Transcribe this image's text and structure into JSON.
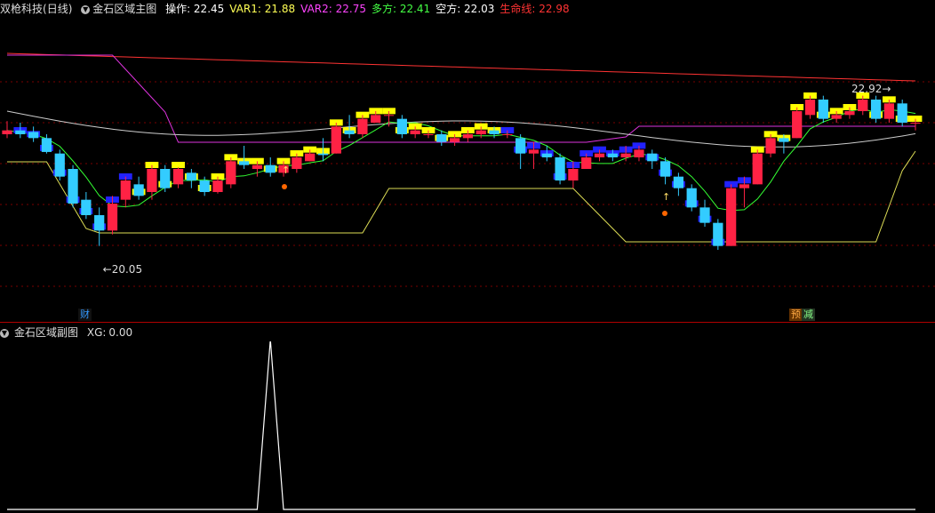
{
  "header": {
    "stock": "双枪科技",
    "period": "(日线)",
    "indicator": "金石区域主图",
    "items": [
      {
        "label": "操作:",
        "value": "22.45",
        "color": "#ffffff"
      },
      {
        "label": "VAR1:",
        "value": "21.88",
        "color": "#ffff55"
      },
      {
        "label": "VAR2:",
        "value": "22.75",
        "color": "#ff44ff"
      },
      {
        "label": "多方:",
        "value": "22.41",
        "color": "#44ff44"
      },
      {
        "label": "空方:",
        "value": "22.03",
        "color": "#ffffff"
      },
      {
        "label": "生命线:",
        "value": "22.98",
        "color": "#ff3333"
      }
    ]
  },
  "main_chart": {
    "high_label": "22.92",
    "low_label": "20.05",
    "badges": [
      {
        "text": "财",
        "color": "#3399ff",
        "bg": "#111"
      },
      {
        "text": "预",
        "color": "#ffaa44",
        "bg": "#663300"
      },
      {
        "text": "减",
        "color": "#88ff88",
        "bg": "#223322"
      }
    ]
  },
  "sub_header": {
    "indicator": "金石区域副图",
    "label": "XG:",
    "value": "0.00"
  },
  "chart_data": {
    "type": "line",
    "series": [
      {
        "name": "XG",
        "values": [
          0,
          0,
          0,
          0,
          0,
          0,
          0,
          0,
          0,
          0,
          0,
          0,
          0,
          0,
          0,
          0,
          0,
          0,
          0,
          0,
          1,
          0,
          0,
          0,
          0,
          0,
          0,
          0,
          0,
          0,
          0,
          0,
          0,
          0,
          0,
          0,
          0,
          0,
          0,
          0,
          0,
          0,
          0,
          0,
          0,
          0,
          0,
          0,
          0,
          0,
          0,
          0,
          0,
          0,
          0,
          0,
          0,
          0,
          0,
          0,
          0,
          0,
          0,
          0,
          0,
          0,
          0,
          0,
          0,
          0
        ]
      }
    ],
    "candles": [
      [
        21.55,
        21.6,
        21.72,
        21.5
      ],
      [
        21.6,
        21.55,
        21.7,
        21.5
      ],
      [
        21.58,
        21.5,
        21.65,
        21.45
      ],
      [
        21.5,
        21.32,
        21.55,
        21.3
      ],
      [
        21.3,
        21.0,
        21.35,
        20.95
      ],
      [
        21.1,
        20.65,
        21.15,
        20.6
      ],
      [
        20.7,
        20.5,
        20.8,
        20.45
      ],
      [
        20.5,
        20.3,
        20.6,
        20.1
      ],
      [
        20.3,
        20.65,
        20.75,
        20.25
      ],
      [
        20.7,
        20.95,
        21.0,
        20.6
      ],
      [
        20.9,
        20.75,
        21.0,
        20.7
      ],
      [
        20.8,
        21.1,
        21.15,
        20.7
      ],
      [
        21.1,
        20.85,
        21.15,
        20.8
      ],
      [
        20.9,
        21.1,
        21.12,
        20.85
      ],
      [
        21.05,
        20.95,
        21.1,
        20.85
      ],
      [
        20.95,
        20.8,
        21.0,
        20.75
      ],
      [
        20.8,
        20.95,
        21.0,
        20.78
      ],
      [
        20.9,
        21.2,
        21.25,
        20.85
      ],
      [
        21.2,
        21.15,
        21.4,
        21.1
      ],
      [
        21.1,
        21.15,
        21.2,
        21.0
      ],
      [
        21.15,
        21.05,
        21.25,
        21.0
      ],
      [
        21.05,
        21.15,
        21.2,
        21.0
      ],
      [
        21.1,
        21.25,
        21.3,
        21.05
      ],
      [
        21.2,
        21.3,
        21.35,
        21.2
      ],
      [
        21.3,
        21.28,
        21.5,
        21.2
      ],
      [
        21.3,
        21.65,
        21.7,
        21.3
      ],
      [
        21.6,
        21.55,
        21.8,
        21.5
      ],
      [
        21.55,
        21.75,
        21.8,
        21.5
      ],
      [
        21.7,
        21.8,
        21.85,
        21.7
      ],
      [
        21.8,
        21.8,
        21.85,
        21.65
      ],
      [
        21.75,
        21.55,
        21.8,
        21.5
      ],
      [
        21.55,
        21.6,
        21.65,
        21.5
      ],
      [
        21.55,
        21.55,
        21.6,
        21.5
      ],
      [
        21.55,
        21.45,
        21.6,
        21.4
      ],
      [
        21.45,
        21.5,
        21.55,
        21.4
      ],
      [
        21.5,
        21.55,
        21.6,
        21.45
      ],
      [
        21.55,
        21.6,
        21.65,
        21.5
      ],
      [
        21.6,
        21.55,
        21.65,
        21.5
      ],
      [
        21.55,
        21.55,
        21.6,
        21.5
      ],
      [
        21.5,
        21.3,
        21.55,
        21.1
      ],
      [
        21.3,
        21.35,
        21.45,
        21.1
      ],
      [
        21.3,
        21.25,
        21.4,
        21.2
      ],
      [
        21.25,
        20.95,
        21.3,
        20.9
      ],
      [
        20.95,
        21.1,
        21.2,
        20.85
      ],
      [
        21.1,
        21.25,
        21.3,
        21.1
      ],
      [
        21.25,
        21.3,
        21.35,
        21.2
      ],
      [
        21.3,
        21.25,
        21.35,
        21.2
      ],
      [
        21.25,
        21.3,
        21.4,
        21.2
      ],
      [
        21.25,
        21.35,
        21.4,
        21.2
      ],
      [
        21.3,
        21.2,
        21.35,
        21.1
      ],
      [
        21.2,
        21.0,
        21.25,
        20.9
      ],
      [
        21.0,
        20.85,
        21.05,
        20.75
      ],
      [
        20.85,
        20.6,
        20.9,
        20.55
      ],
      [
        20.6,
        20.4,
        20.7,
        20.35
      ],
      [
        20.4,
        20.1,
        20.45,
        20.05
      ],
      [
        20.1,
        20.85,
        20.9,
        20.1
      ],
      [
        20.85,
        20.9,
        21.0,
        20.6
      ],
      [
        20.9,
        21.3,
        21.35,
        20.9
      ],
      [
        21.3,
        21.5,
        21.55,
        21.25
      ],
      [
        21.5,
        21.45,
        21.55,
        21.3
      ],
      [
        21.5,
        21.85,
        21.9,
        21.5
      ],
      [
        21.8,
        22.0,
        22.05,
        21.75
      ],
      [
        22.0,
        21.75,
        22.05,
        21.7
      ],
      [
        21.75,
        21.8,
        21.85,
        21.7
      ],
      [
        21.8,
        21.85,
        21.9,
        21.75
      ],
      [
        21.85,
        22.0,
        22.05,
        21.8
      ],
      [
        22.0,
        21.75,
        22.05,
        21.7
      ],
      [
        21.75,
        21.95,
        22.0,
        21.7
      ],
      [
        21.95,
        21.7,
        22.0,
        21.65
      ],
      [
        21.7,
        21.7,
        21.75,
        21.6
      ]
    ]
  }
}
